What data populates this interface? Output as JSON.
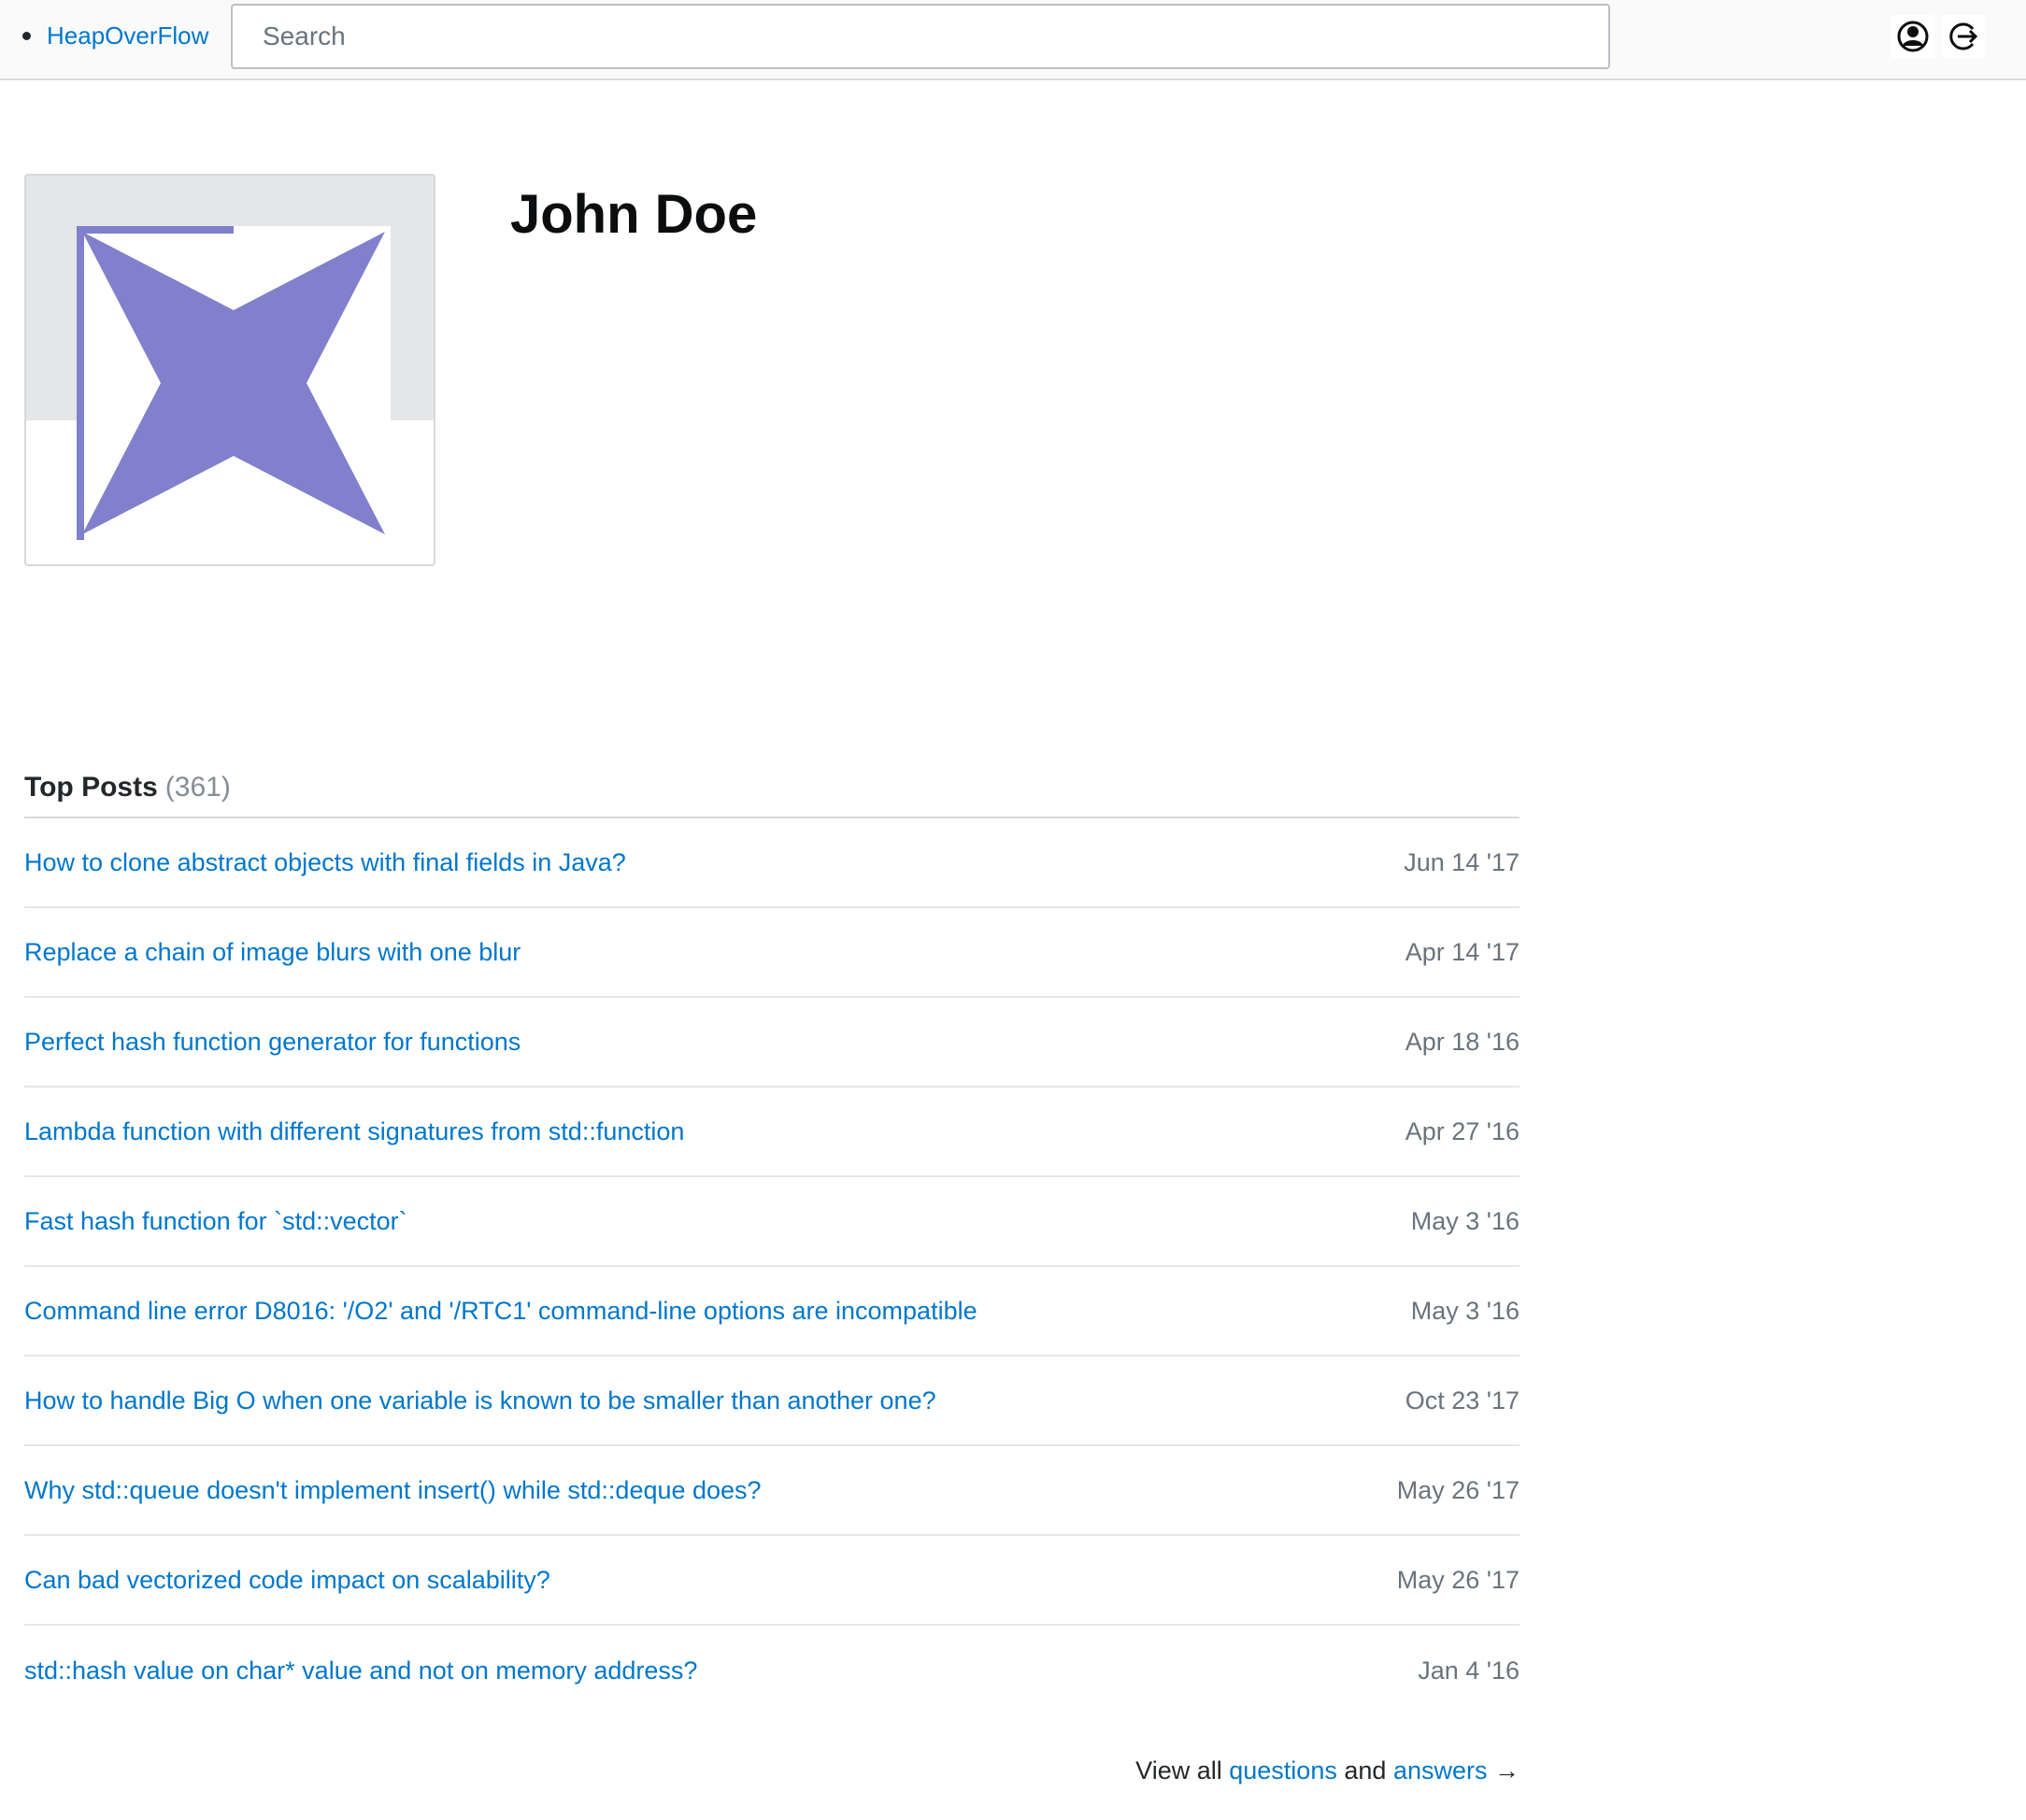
{
  "header": {
    "brand": "HeapOverFlow",
    "search_placeholder": "Search",
    "icons": [
      "user-icon",
      "logout-icon"
    ]
  },
  "profile": {
    "name": "John Doe",
    "avatar_color": "#8080cc"
  },
  "top_posts": {
    "title": "Top Posts",
    "count": "(361)",
    "items": [
      {
        "title": "How to clone abstract objects with final fields in Java?",
        "date": "Jun 14 '17"
      },
      {
        "title": "Replace a chain of image blurs with one blur",
        "date": "Apr 14 '17"
      },
      {
        "title": "Perfect hash function generator for functions",
        "date": "Apr 18 '16"
      },
      {
        "title": "Lambda function with different signatures from std::function",
        "date": "Apr 27 '16"
      },
      {
        "title": "Fast hash function for `std::vector`",
        "date": "May 3 '16"
      },
      {
        "title": "Command line error D8016: '/O2' and '/RTC1' command-line options are incompatible",
        "date": "May 3 '16"
      },
      {
        "title": "How to handle Big O when one variable is known to be smaller than another one?",
        "date": "Oct 23 '17"
      },
      {
        "title": "Why std::queue doesn't implement insert() while std::deque does?",
        "date": "May 26 '17"
      },
      {
        "title": "Can bad vectorized code impact on scalability?",
        "date": "May 26 '17"
      },
      {
        "title": "std::hash value on char* value and not on memory address?",
        "date": "Jan 4 '16"
      }
    ]
  },
  "footer": {
    "view_all": "View all",
    "questions": "questions",
    "and": "and",
    "answers": "answers",
    "arrow": "→"
  },
  "colors": {
    "link": "#0077cc",
    "muted": "#6a737c",
    "border": "#d6d9dc"
  }
}
